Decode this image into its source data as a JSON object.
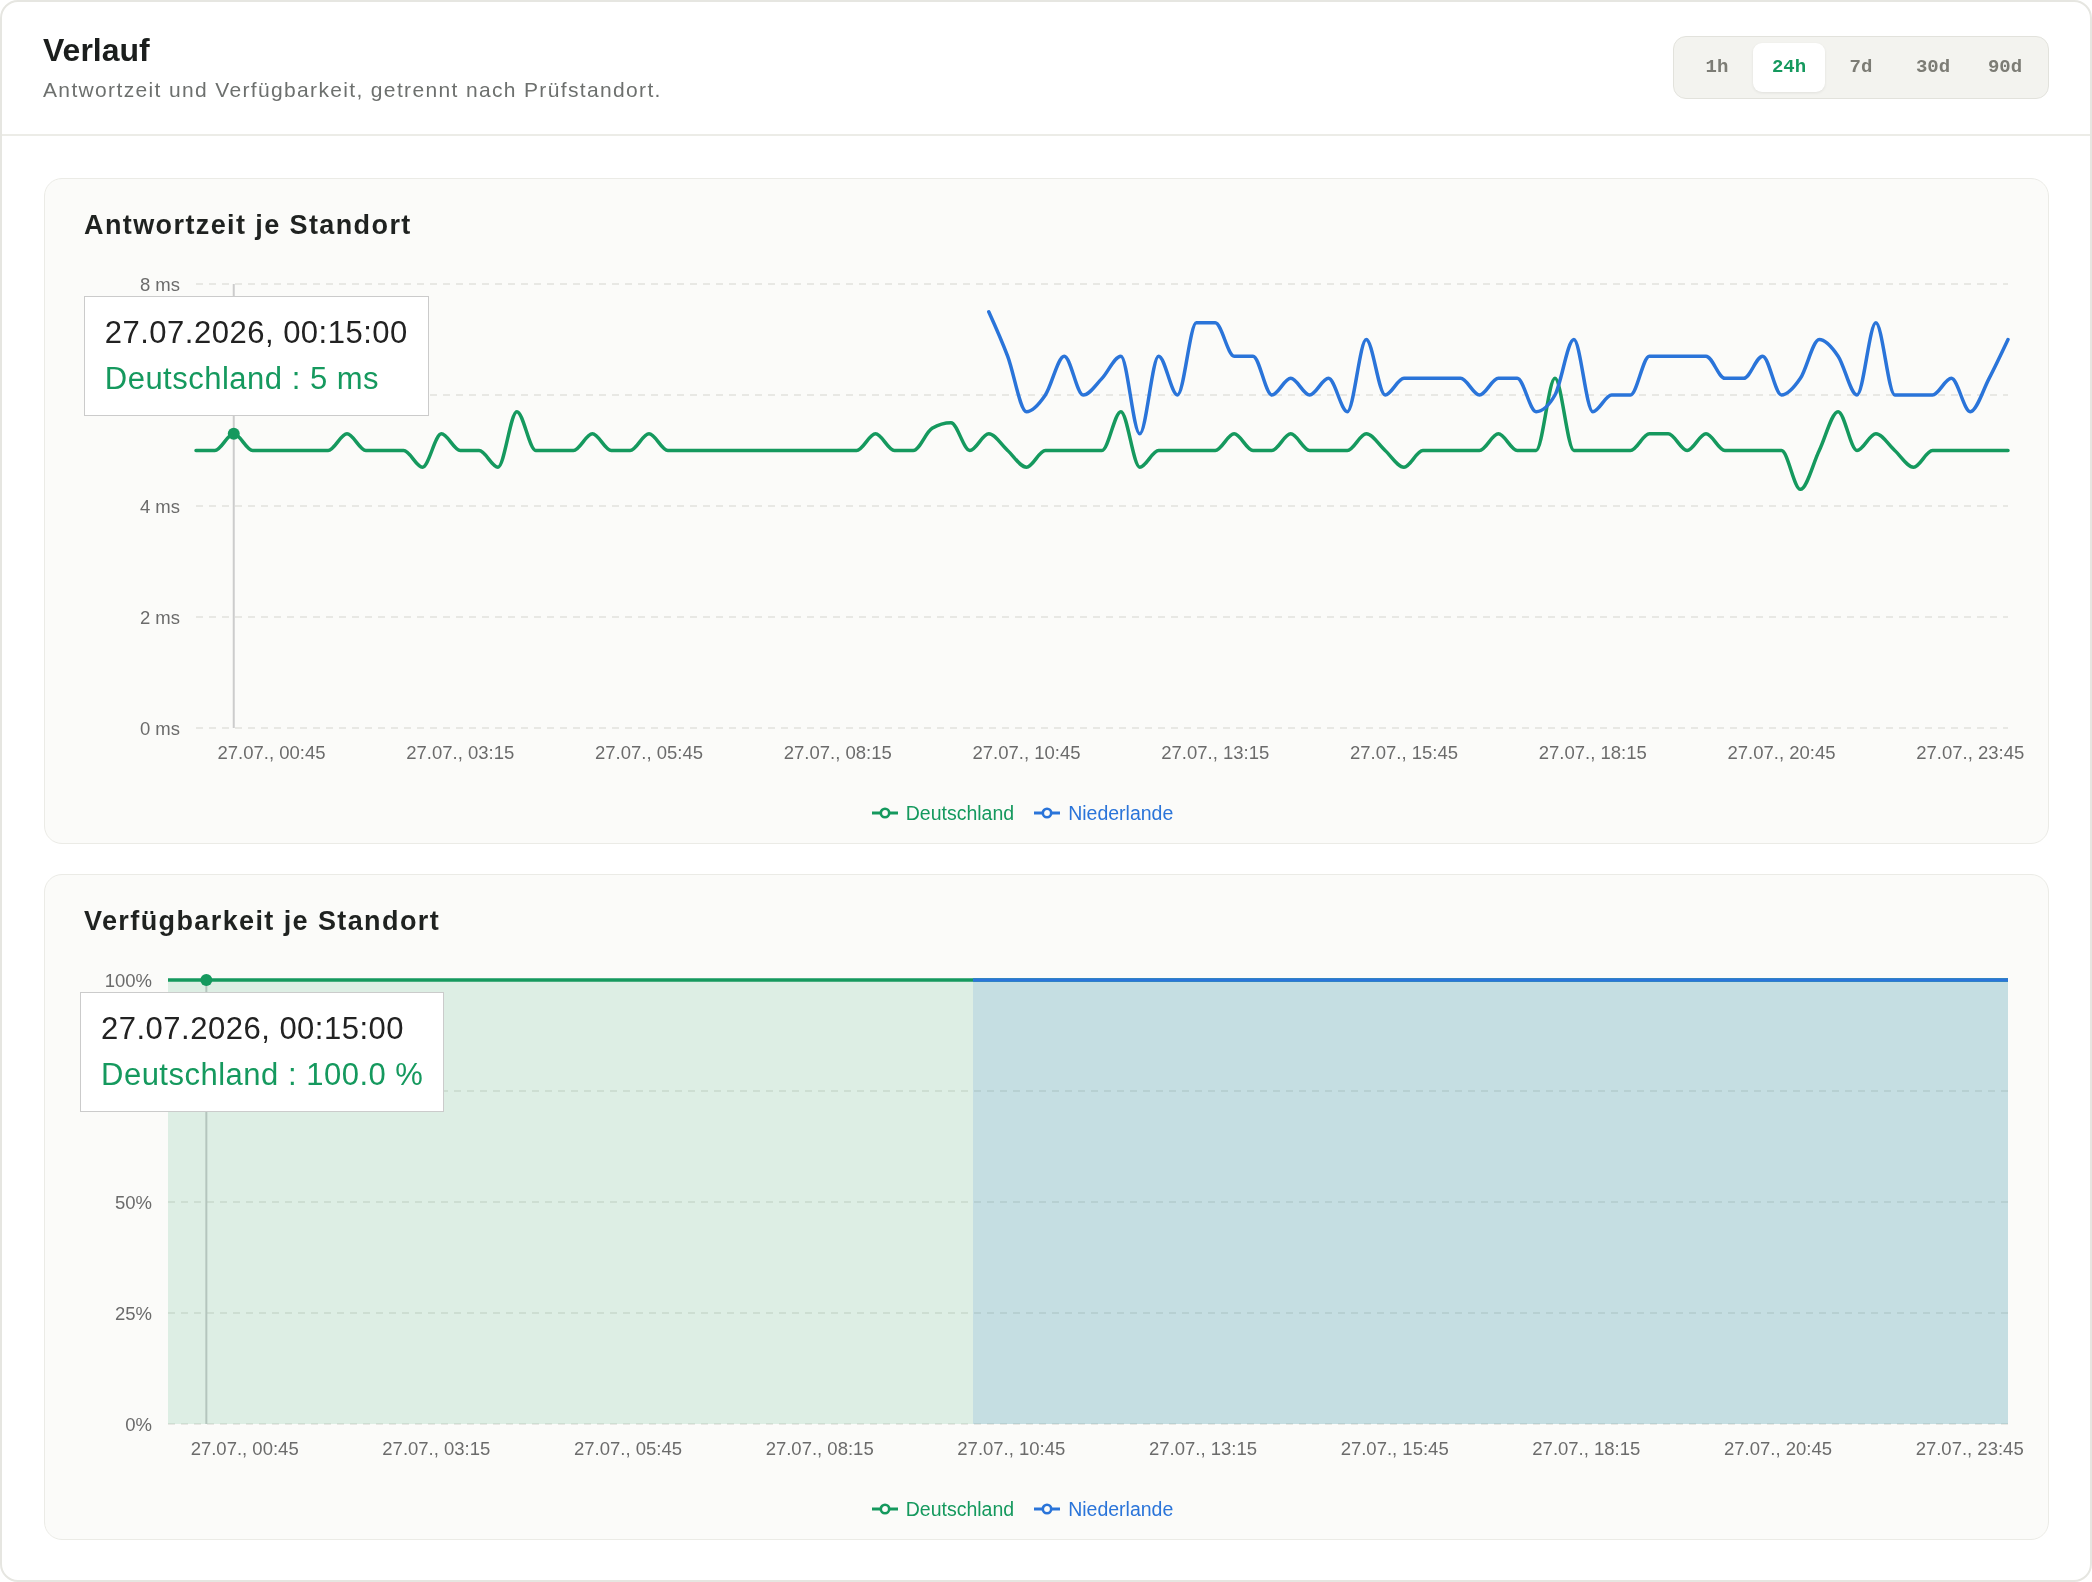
{
  "header": {
    "title": "Verlauf",
    "subtitle": "Antwortzeit und Verfügbarkeit, getrennt nach Prüfstandort."
  },
  "range_tabs": [
    {
      "label": "1h",
      "selected": false
    },
    {
      "label": "24h",
      "selected": true
    },
    {
      "label": "7d",
      "selected": false
    },
    {
      "label": "30d",
      "selected": false
    },
    {
      "label": "90d",
      "selected": false
    }
  ],
  "panels": [
    {
      "title": "Antwortzeit je Standort",
      "chart_data": {
        "type": "line",
        "categories": [
          null,
          null,
          null,
          null,
          "27.07., 00:45",
          null,
          null,
          null,
          null,
          null,
          null,
          null,
          null,
          null,
          "27.07., 03:15",
          null,
          null,
          null,
          null,
          null,
          null,
          null,
          null,
          null,
          "27.07., 05:45",
          null,
          null,
          null,
          null,
          null,
          null,
          null,
          null,
          null,
          "27.07., 08:15",
          null,
          null,
          null,
          null,
          null,
          null,
          null,
          null,
          null,
          "27.07., 10:45",
          null,
          null,
          null,
          null,
          null,
          null,
          null,
          null,
          null,
          "27.07., 13:15",
          null,
          null,
          null,
          null,
          null,
          null,
          null,
          null,
          null,
          "27.07., 15:45",
          null,
          null,
          null,
          null,
          null,
          null,
          null,
          null,
          null,
          "27.07., 18:15",
          null,
          null,
          null,
          null,
          null,
          null,
          null,
          null,
          null,
          "27.07., 20:45",
          null,
          null,
          null,
          null,
          null,
          null,
          null,
          null,
          null,
          "27.07., 23:45",
          null,
          null
        ],
        "ylim": [
          0,
          8
        ],
        "yticks": [
          {
            "value": 0,
            "label": "0 ms"
          },
          {
            "value": 2,
            "label": "2 ms"
          },
          {
            "value": 4,
            "label": "4 ms"
          },
          {
            "value": 8,
            "label": "8 ms"
          }
        ],
        "series": [
          {
            "name": "Deutschland",
            "color": "#15995e",
            "values": [
              5,
              5,
              5.3,
              5,
              5,
              5,
              5,
              5,
              5.3,
              5,
              5,
              5,
              4.7,
              5.3,
              5,
              5,
              4.7,
              5.7,
              5,
              5,
              5,
              5.3,
              5,
              5,
              5.3,
              5,
              5,
              5,
              5,
              5,
              5,
              5,
              5,
              5,
              5,
              5,
              5.3,
              5,
              5,
              5.4,
              5.5,
              5,
              5.3,
              5,
              4.7,
              5,
              5,
              5,
              5,
              5.7,
              4.7,
              5,
              5,
              5,
              5,
              5.3,
              5,
              5,
              5.3,
              5,
              5,
              5,
              5.3,
              5,
              4.7,
              5,
              5,
              5,
              5,
              5.3,
              5,
              5,
              6.3,
              5,
              5,
              5,
              5,
              5.3,
              5.3,
              5,
              5.3,
              5,
              5,
              5,
              5,
              4.3,
              5,
              5.7,
              5,
              5.3,
              5,
              4.7,
              5,
              5,
              5,
              5,
              5
            ]
          },
          {
            "name": "Niederlande",
            "color": "#2a74d9",
            "values": [
              null,
              null,
              null,
              null,
              null,
              null,
              null,
              null,
              null,
              null,
              null,
              null,
              null,
              null,
              null,
              null,
              null,
              null,
              null,
              null,
              null,
              null,
              null,
              null,
              null,
              null,
              null,
              null,
              null,
              null,
              null,
              null,
              null,
              null,
              null,
              null,
              null,
              null,
              null,
              null,
              null,
              null,
              7.5,
              6.7,
              5.7,
              6,
              6.7,
              6,
              6.3,
              6.7,
              5.3,
              6.7,
              6,
              7.3,
              7.3,
              6.7,
              6.7,
              6,
              6.3,
              6,
              6.3,
              5.7,
              7,
              6,
              6.3,
              6.3,
              6.3,
              6.3,
              6,
              6.3,
              6.3,
              5.7,
              6,
              7,
              5.7,
              6,
              6,
              6.7,
              6.7,
              6.7,
              6.7,
              6.3,
              6.3,
              6.7,
              6,
              6.3,
              7,
              6.7,
              6,
              7.3,
              6,
              6,
              6,
              6.3,
              5.7,
              6.3,
              7
            ]
          }
        ],
        "legend": "bottom"
      },
      "tooltip": {
        "title": "27.07.2026, 00:15:00",
        "entries": [
          {
            "label": "Deutschland : 5 ms",
            "color": "#15995e"
          }
        ]
      }
    },
    {
      "title": "Verfügbarkeit je Standort",
      "chart_data": {
        "type": "area",
        "categories": [
          null,
          null,
          null,
          null,
          "27.07., 00:45",
          null,
          null,
          null,
          null,
          null,
          null,
          null,
          null,
          null,
          "27.07., 03:15",
          null,
          null,
          null,
          null,
          null,
          null,
          null,
          null,
          null,
          "27.07., 05:45",
          null,
          null,
          null,
          null,
          null,
          null,
          null,
          null,
          null,
          "27.07., 08:15",
          null,
          null,
          null,
          null,
          null,
          null,
          null,
          null,
          null,
          "27.07., 10:45",
          null,
          null,
          null,
          null,
          null,
          null,
          null,
          null,
          null,
          "27.07., 13:15",
          null,
          null,
          null,
          null,
          null,
          null,
          null,
          null,
          null,
          "27.07., 15:45",
          null,
          null,
          null,
          null,
          null,
          null,
          null,
          null,
          null,
          "27.07., 18:15",
          null,
          null,
          null,
          null,
          null,
          null,
          null,
          null,
          null,
          "27.07., 20:45",
          null,
          null,
          null,
          null,
          null,
          null,
          null,
          null,
          null,
          "27.07., 23:45",
          null,
          null
        ],
        "ylim": [
          0,
          100
        ],
        "yticks": [
          {
            "value": 0,
            "label": "0%"
          },
          {
            "value": 25,
            "label": "25%"
          },
          {
            "value": 50,
            "label": "50%"
          },
          {
            "value": 100,
            "label": "100%"
          }
        ],
        "series": [
          {
            "name": "Deutschland",
            "color": "#15995e",
            "values": [
              100,
              100,
              100,
              100,
              100,
              100,
              100,
              100,
              100,
              100,
              100,
              100,
              100,
              100,
              100,
              100,
              100,
              100,
              100,
              100,
              100,
              100,
              100,
              100,
              100,
              100,
              100,
              100,
              100,
              100,
              100,
              100,
              100,
              100,
              100,
              100,
              100,
              100,
              100,
              100,
              100,
              100,
              100,
              100,
              100,
              100,
              100,
              100,
              100,
              100,
              100,
              100,
              100,
              100,
              100,
              100,
              100,
              100,
              100,
              100,
              100,
              100,
              100,
              100,
              100,
              100,
              100,
              100,
              100,
              100,
              100,
              100,
              100,
              100,
              100,
              100,
              100,
              100,
              100,
              100,
              100,
              100,
              100,
              100,
              100,
              100,
              100,
              100,
              100,
              100,
              100,
              100,
              100,
              100,
              100,
              100,
              100
            ]
          },
          {
            "name": "Niederlande",
            "color": "#2a74d9",
            "values": [
              null,
              null,
              null,
              null,
              null,
              null,
              null,
              null,
              null,
              null,
              null,
              null,
              null,
              null,
              null,
              null,
              null,
              null,
              null,
              null,
              null,
              null,
              null,
              null,
              null,
              null,
              null,
              null,
              null,
              null,
              null,
              null,
              null,
              null,
              null,
              null,
              null,
              null,
              null,
              null,
              null,
              null,
              100,
              100,
              100,
              100,
              100,
              100,
              100,
              100,
              100,
              100,
              100,
              100,
              100,
              100,
              100,
              100,
              100,
              100,
              100,
              100,
              100,
              100,
              100,
              100,
              100,
              100,
              100,
              100,
              100,
              100,
              100,
              100,
              100,
              100,
              100,
              100,
              100,
              100,
              100,
              100,
              100,
              100,
              100,
              100,
              100,
              100,
              100,
              100,
              100,
              100,
              100,
              100,
              100,
              100,
              100
            ]
          }
        ],
        "legend": "bottom"
      },
      "tooltip": {
        "title": "27.07.2026, 00:15:00",
        "entries": [
          {
            "label": "Deutschland : 100.0 %",
            "color": "#15995e"
          }
        ]
      }
    }
  ]
}
